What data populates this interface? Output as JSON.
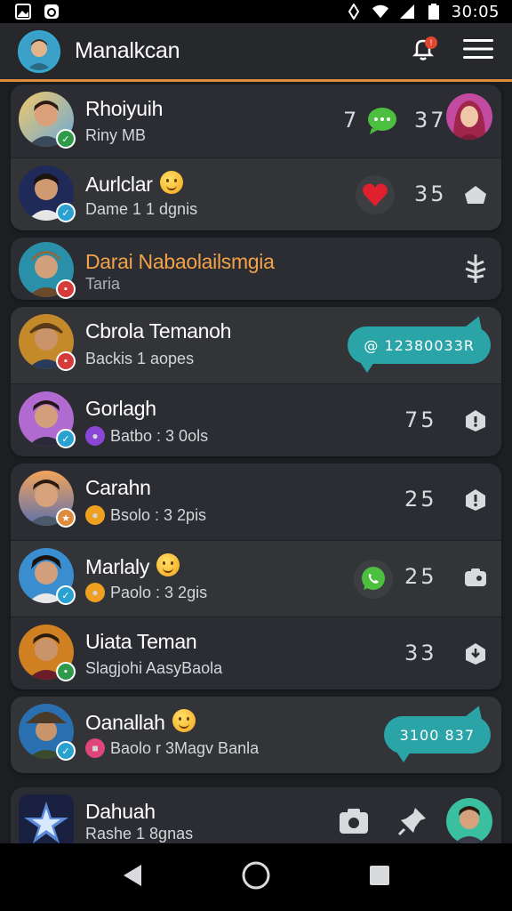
{
  "status_bar": {
    "time": "30:05",
    "icons": [
      "gallery-icon",
      "app-notification-icon",
      "vibrate-icon",
      "wifi-icon",
      "signal-icon",
      "battery-icon"
    ]
  },
  "app_bar": {
    "title": "Manalkcan",
    "notification_count": "!",
    "icons": [
      "avatar",
      "notification-bell-icon",
      "menu-icon"
    ]
  },
  "colors": {
    "accent": "#e08a3c",
    "teal": "#2ba4a8",
    "green": "#3aa845",
    "background": "#1c1e22",
    "card": "#2b2d32"
  },
  "contacts": [
    {
      "name": "Rhoiyuih",
      "sub": "Riny MB",
      "count": "7",
      "count2": "37",
      "right": "avatar-girl",
      "badge_color": "#2f9b4a",
      "badge_icon": "chat"
    },
    {
      "name": "Aurlclar",
      "sub": "Dame 1 1 dgnis",
      "count": "35",
      "right": "home-icon",
      "badge_color": "#2aa1d0",
      "badge_icon": "check",
      "emoji": true
    },
    {
      "name": "Darai Nabaolailsmgia",
      "sub": "Taria",
      "right": "tree-icon",
      "badge_color": "#d53b3b",
      "badge_icon": "chat"
    },
    {
      "name": "Cbrola Temanoh",
      "sub": "Backis 1 aopes",
      "pill": "@ 12380033R",
      "badge_color": "#d53b3b",
      "badge_icon": "chat"
    },
    {
      "name": "Gorlagh",
      "sub": "Batbo : 3 0ols",
      "count": "75",
      "right": "tag-icon",
      "badge_color": "#2aa1d0",
      "badge_icon": "check",
      "sub_icon_color": "#8b46d6"
    },
    {
      "name": "Carahn",
      "sub": "Bsolo : 3 2pis",
      "count": "25",
      "right": "info-icon",
      "badge_color": "#e08a3c",
      "badge_icon": "star",
      "sub_icon_color": "#f0a020"
    },
    {
      "name": "Marlaly",
      "sub": "Paolo : 3 2gis",
      "count": "25",
      "right": "camera-icon",
      "badge_color": "#2aa1d0",
      "badge_icon": "check",
      "sub_icon_color": "#f0a020",
      "emoji": true
    },
    {
      "name": "Uiata Teman",
      "sub": "Slagjohi AasyBaola",
      "count": "33",
      "right": "download-icon",
      "badge_color": "#2f9b4a",
      "badge_icon": "chat"
    },
    {
      "name": "Oanallah",
      "sub": "Baolo r 3Magv Banla",
      "pill": "3100 837",
      "badge_color": "#2aa1d0",
      "badge_icon": "check",
      "sub_icon_color": "#e0457a",
      "emoji": true
    },
    {
      "name": "Dahuah",
      "sub": "Rashe 1 8gnas",
      "right": "avatar-boy"
    }
  ],
  "nav_bar": {
    "icons": [
      "back-icon",
      "home-circle-icon",
      "recents-icon"
    ]
  }
}
